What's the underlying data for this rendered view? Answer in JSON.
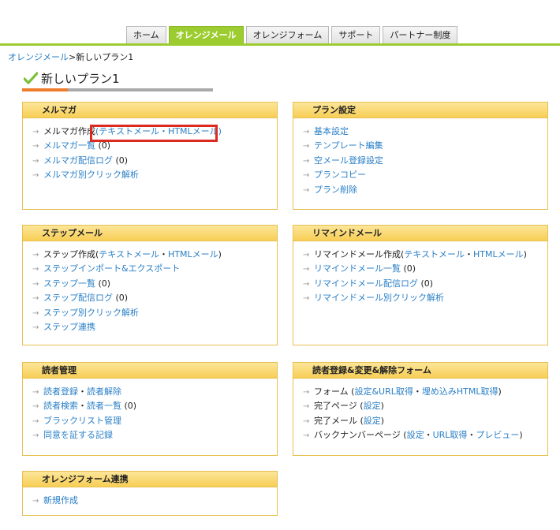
{
  "nav": {
    "tabs": [
      {
        "label": "ホーム",
        "active": false
      },
      {
        "label": "オレンジメール",
        "active": true
      },
      {
        "label": "オレンジフォーム",
        "active": false
      },
      {
        "label": "サポート",
        "active": false
      },
      {
        "label": "パートナー制度",
        "active": false
      }
    ]
  },
  "breadcrumb": {
    "root": "オレンジメール",
    "separator": ">",
    "current": "新しいプラン1"
  },
  "page_title": "新しいプラン1",
  "panels": {
    "merumaga": {
      "title": "メルマガ",
      "create_prefix": "メルマガ作成",
      "open_paren": "(",
      "text_mail": "テキストメール",
      "dot": "・",
      "html_mail": "HTMLメール",
      "close_paren": ")",
      "list": "メルマガ一覧",
      "list_count": "(0)",
      "log": "メルマガ配信ログ",
      "log_count": "(0)",
      "click": "メルマガ別クリック解析"
    },
    "plan": {
      "title": "プラン設定",
      "items": [
        "基本設定",
        "テンプレート編集",
        "空メール登録設定",
        "プランコピー",
        "プラン削除"
      ]
    },
    "step": {
      "title": "ステップメール",
      "create_prefix": "ステップ作成",
      "open_paren": "(",
      "text_mail": "テキストメール",
      "dot": "・",
      "html_mail": "HTMLメール",
      "close_paren": ")",
      "import": "ステップインポート&エクスポート",
      "list": "ステップ一覧",
      "list_count": "(0)",
      "log": "ステップ配信ログ",
      "log_count": "(0)",
      "click": "ステップ別クリック解析",
      "link": "ステップ連携"
    },
    "remind": {
      "title": "リマインドメール",
      "create_prefix": "リマインドメール作成",
      "open_paren": "(",
      "text_mail": "テキストメール",
      "dot": "・",
      "html_mail": "HTMLメール",
      "close_paren": ")",
      "list": "リマインドメール一覧",
      "list_count": "(0)",
      "log": "リマインドメール配信ログ",
      "log_count": "(0)",
      "click": "リマインドメール別クリック解析"
    },
    "readers": {
      "title": "読者管理",
      "register": "読者登録",
      "dot": "・",
      "cancel": "読者解除",
      "search": "読者検索",
      "list": "読者一覧",
      "list_count": "(0)",
      "blacklist": "ブラックリスト管理",
      "consent": "同意を証する記録"
    },
    "forms": {
      "title": "読者登録&変更&解除フォーム",
      "form_prefix": "フォーム",
      "open_paren": "(",
      "settings": "設定",
      "amp": "&",
      "url": "URL取得",
      "dot": "・",
      "embed": "埋め込みHTML取得",
      "close_paren": ")",
      "done_page": "完了ページ",
      "done_mail": "完了メール",
      "backnumber": "バックナンバーページ",
      "preview": "プレビュー"
    },
    "orange_form": {
      "title": "オレンジフォーム連携",
      "new": "新規作成"
    }
  },
  "colors": {
    "accent_green": "#9ccc2f",
    "panel_header": "#f7ce55",
    "link": "#2a7fc6",
    "highlight": "#dd2a21",
    "title_orange": "#ee7d2b"
  },
  "icons": {
    "arrow": "→",
    "check": "check-icon"
  }
}
